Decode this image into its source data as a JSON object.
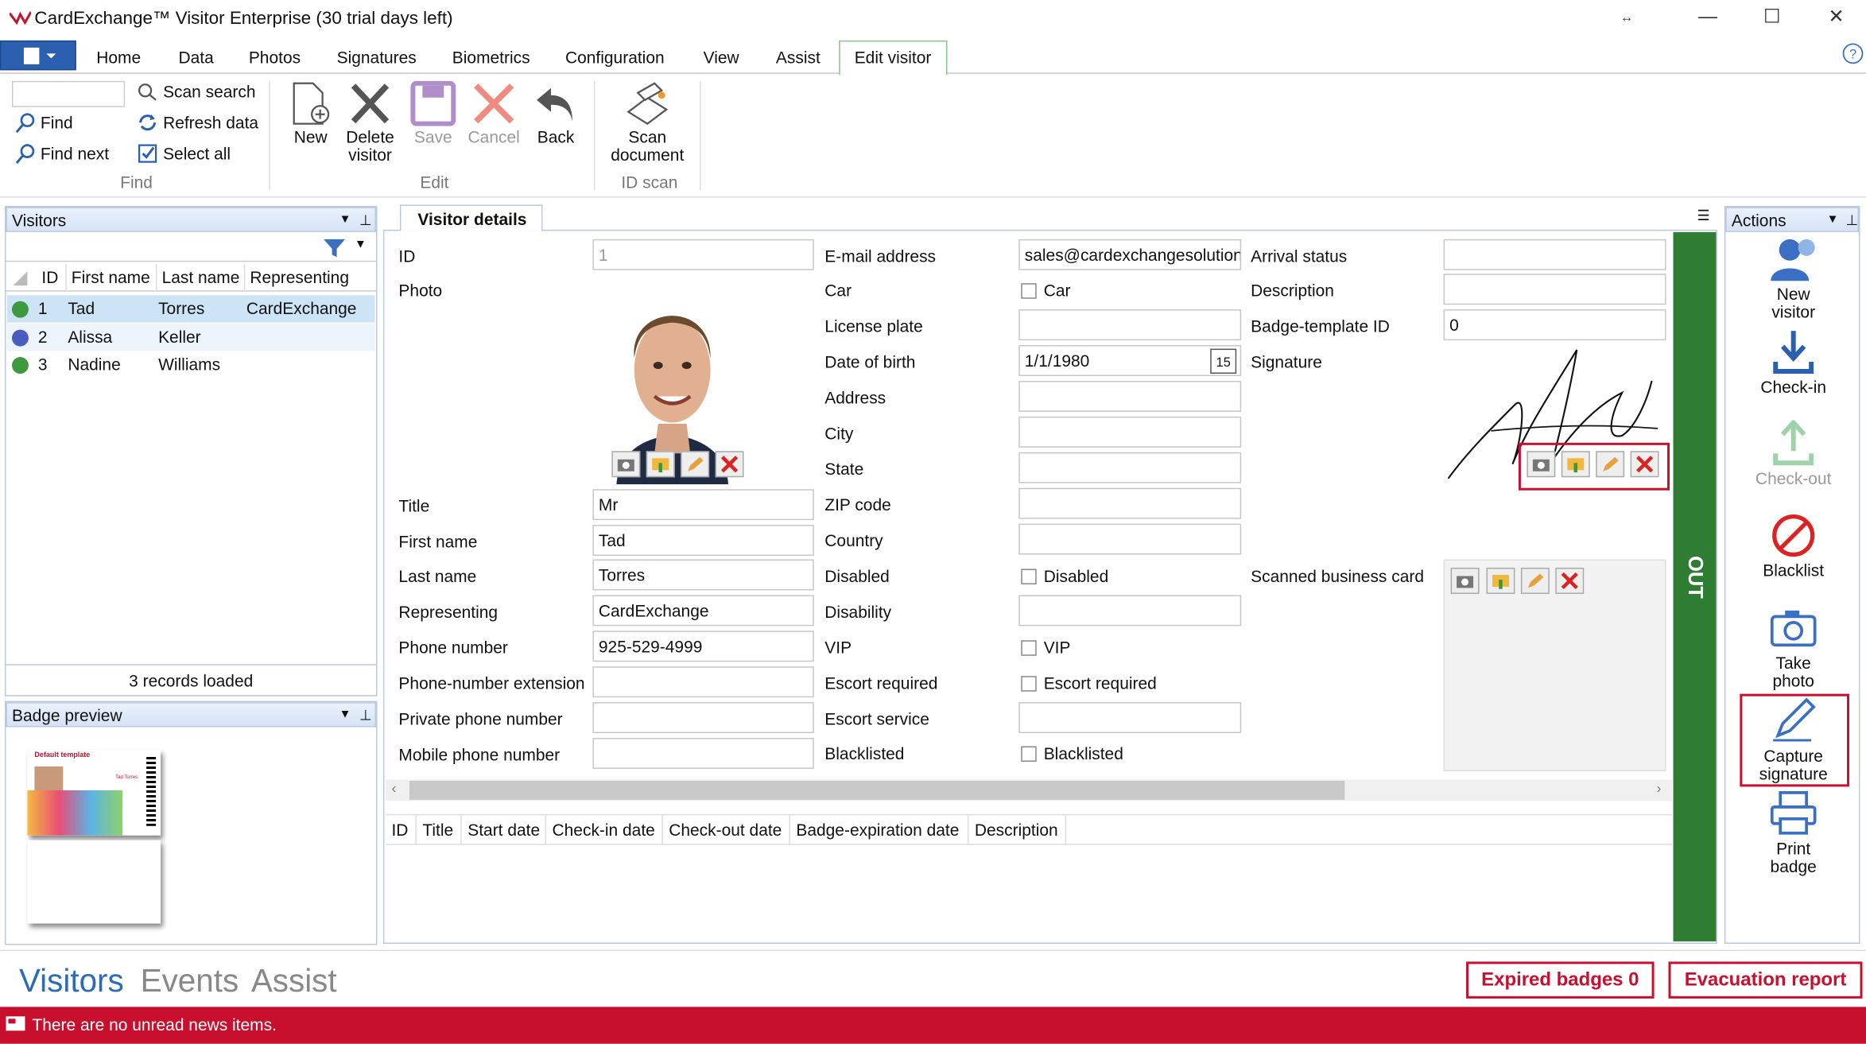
{
  "window": {
    "title": "CardExchange™ Visitor Enterprise (30 trial days left)"
  },
  "menu": {
    "tabs": [
      "Home",
      "Data",
      "Photos",
      "Signatures",
      "Biometrics",
      "Configuration",
      "View",
      "Assist",
      "Edit visitor"
    ]
  },
  "ribbon": {
    "find": {
      "scan_search": "Scan search",
      "find": "Find",
      "refresh": "Refresh data",
      "find_next": "Find next",
      "select_all": "Select all",
      "group": "Find"
    },
    "edit": {
      "new": "New",
      "delete_1": "Delete",
      "delete_2": "visitor",
      "save": "Save",
      "cancel": "Cancel",
      "back": "Back",
      "group": "Edit"
    },
    "idscan": {
      "scan_1": "Scan",
      "scan_2": "document",
      "group": "ID scan"
    }
  },
  "visitors": {
    "title": "Visitors",
    "columns": [
      "ID",
      "First name",
      "Last name",
      "Representing"
    ],
    "rows": [
      {
        "id": "1",
        "first": "Tad",
        "last": "Torres",
        "rep": "CardExchange",
        "color": "#3c9a3c"
      },
      {
        "id": "2",
        "first": "Alissa",
        "last": "Keller",
        "rep": "",
        "color": "#4a5dbf"
      },
      {
        "id": "3",
        "first": "Nadine",
        "last": "Williams",
        "rep": "",
        "color": "#3c9a3c"
      }
    ],
    "footer": "3 records loaded"
  },
  "badge_preview": {
    "title": "Badge preview",
    "template_name": "Default template",
    "card_name": "Tad Torres"
  },
  "details": {
    "tab": "Visitor details",
    "col1": {
      "id": "ID",
      "id_val": "1",
      "photo": "Photo",
      "title": "Title",
      "title_val": "Mr",
      "first": "First name",
      "first_val": "Tad",
      "last": "Last name",
      "last_val": "Torres",
      "rep": "Representing",
      "rep_val": "CardExchange",
      "phone": "Phone number",
      "phone_val": "925-529-4999",
      "ext": "Phone-number extension",
      "private": "Private phone number",
      "mobile": "Mobile phone number"
    },
    "col2": {
      "email": "E-mail address",
      "email_val": "sales@cardexchangesolution",
      "car": "Car",
      "car_cb": "Car",
      "plate": "License plate",
      "dob": "Date of birth",
      "dob_val": "1/1/1980",
      "cal_day": "15",
      "address": "Address",
      "city": "City",
      "state": "State",
      "zip": "ZIP code",
      "country": "Country",
      "disabled": "Disabled",
      "disabled_cb": "Disabled",
      "disability": "Disability",
      "vip": "VIP",
      "vip_cb": "VIP",
      "escort_req": "Escort required",
      "escort_req_cb": "Escort required",
      "escort_svc": "Escort service",
      "blacklisted": "Blacklisted",
      "blacklisted_cb": "Blacklisted"
    },
    "col3": {
      "arrival": "Arrival status",
      "description": "Description",
      "badge_tpl": "Badge-template ID",
      "badge_tpl_val": "0",
      "signature": "Signature",
      "business_card": "Scanned business card"
    },
    "status": "OUT",
    "events_columns": [
      "ID",
      "Title",
      "Start date",
      "Check-in date",
      "Check-out date",
      "Badge-expiration date",
      "Description"
    ]
  },
  "actions": {
    "title": "Actions",
    "items": [
      {
        "l1": "New",
        "l2": "visitor"
      },
      {
        "l1": "Check-in",
        "l2": ""
      },
      {
        "l1": "Check-out",
        "l2": ""
      },
      {
        "l1": "Blacklist",
        "l2": ""
      },
      {
        "l1": "Take",
        "l2": "photo"
      },
      {
        "l1": "Capture",
        "l2": "signature"
      },
      {
        "l1": "Print",
        "l2": "badge"
      }
    ]
  },
  "bottom": {
    "nav": [
      "Visitors",
      "Events",
      "Assist"
    ],
    "expired": "Expired badges 0",
    "evac": "Evacuation report",
    "news": "There are no unread news items."
  },
  "colors": {
    "accent_red": "#c8102e",
    "status_green": "#2e7d32",
    "news_bar": "#c8102e"
  }
}
